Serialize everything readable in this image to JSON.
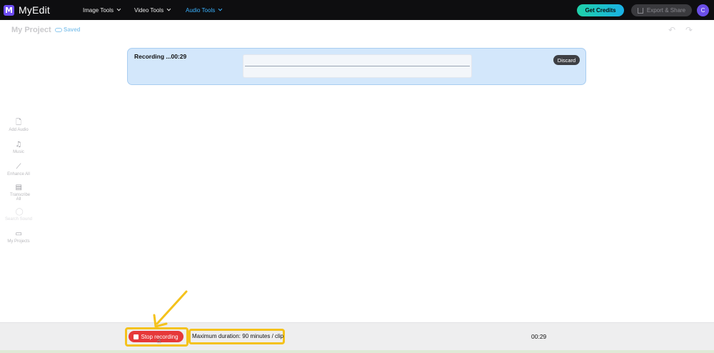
{
  "app": {
    "logo_letter": "M",
    "name": "MyEdit"
  },
  "nav": [
    {
      "label": "Image Tools",
      "active": false
    },
    {
      "label": "Video Tools",
      "active": false
    },
    {
      "label": "Audio Tools",
      "active": true
    }
  ],
  "header_buttons": {
    "credits": "Get Credits",
    "export": "Export & Share",
    "avatar_initial": "C"
  },
  "project": {
    "title": "My Project",
    "status": "Saved"
  },
  "recording": {
    "label": "Recording ...00:29",
    "discard": "Discard"
  },
  "sidebar": [
    {
      "label": "Add Audio",
      "icon": "add-audio-icon",
      "enabled": true
    },
    {
      "label": "Music",
      "icon": "music-icon",
      "enabled": true
    },
    {
      "label": "Enhance All",
      "icon": "magic-wand-icon",
      "enabled": true
    },
    {
      "label": "Transcribe All",
      "icon": "transcribe-icon",
      "enabled": true
    },
    {
      "label": "Search Sound",
      "icon": "search-sound-icon",
      "enabled": false
    },
    {
      "label": "My Projects",
      "icon": "folder-icon",
      "enabled": true
    }
  ],
  "bottom": {
    "stop_label": "Stop recording",
    "max_duration": "Maximum duration: 90 minutes / clip",
    "timer": "00:29"
  },
  "colors": {
    "accent": "#3ab3ff",
    "stop": "#e6383a",
    "highlight": "#f4c21c",
    "brand": "#6c4cf1"
  }
}
